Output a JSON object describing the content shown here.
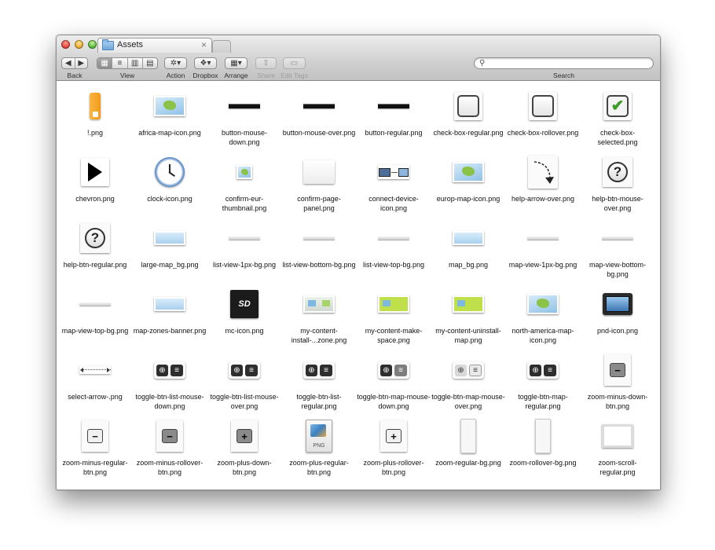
{
  "window": {
    "tab_title": "Assets",
    "tab_close": "×"
  },
  "toolbar": {
    "back_label": "Back",
    "view_label": "View",
    "action_label": "Action",
    "dropbox_label": "Dropbox",
    "arrange_label": "Arrange",
    "share_label": "Share",
    "edit_tags_label": "Edit Tags",
    "search_label": "Search",
    "search_value": "",
    "back_glyph": "◀",
    "forward_glyph": "▶",
    "action_glyph": "✲▾",
    "dropbox_glyph": "❖▾",
    "arrange_glyph": "▦▾",
    "share_glyph": "⇪",
    "edit_tags_glyph": "▭",
    "search_glyph": "⚲",
    "view_icons": [
      "▦",
      "≡",
      "▥",
      "▤"
    ]
  },
  "files": [
    {
      "name": "!.png",
      "kind": "exclaim"
    },
    {
      "name": "africa-map-icon.png",
      "kind": "map"
    },
    {
      "name": "button-mouse-down.png",
      "kind": "blackbar"
    },
    {
      "name": "button-mouse-over.png",
      "kind": "blackbar"
    },
    {
      "name": "button-regular.png",
      "kind": "blackbar"
    },
    {
      "name": "check-box-regular.png",
      "kind": "checkbox"
    },
    {
      "name": "check-box-rollover.png",
      "kind": "checkbox"
    },
    {
      "name": "check-box-selected.png",
      "kind": "checkbox-on"
    },
    {
      "name": "chevron.png",
      "kind": "chevron"
    },
    {
      "name": "clock-icon.png",
      "kind": "clock"
    },
    {
      "name": "confirm-eur-thumbnail.png",
      "kind": "smallmap"
    },
    {
      "name": "confirm-page-panel.png",
      "kind": "panel"
    },
    {
      "name": "connect-device-icon.png",
      "kind": "device"
    },
    {
      "name": "europ-map-icon.png",
      "kind": "map"
    },
    {
      "name": "help-arrow-over.png",
      "kind": "arrow"
    },
    {
      "name": "help-btn-mouse-over.png",
      "kind": "help"
    },
    {
      "name": "help-btn-regular.png",
      "kind": "help"
    },
    {
      "name": "large-map_bg.png",
      "kind": "cloudbar"
    },
    {
      "name": "list-view-1px-bg.png",
      "kind": "thinbar"
    },
    {
      "name": "list-view-bottom-bg.png",
      "kind": "thinbar"
    },
    {
      "name": "list-view-top-bg.png",
      "kind": "thinbar"
    },
    {
      "name": "map_bg.png",
      "kind": "cloudbar"
    },
    {
      "name": "map-view-1px-bg.png",
      "kind": "thinbar"
    },
    {
      "name": "map-view-bottom-bg.png",
      "kind": "thinbar"
    },
    {
      "name": "map-view-top-bg.png",
      "kind": "thinbar"
    },
    {
      "name": "map-zones-banner.png",
      "kind": "cloudbar"
    },
    {
      "name": "mc-icon.png",
      "kind": "sd"
    },
    {
      "name": "my-content-install-...zone.png",
      "kind": "greymap"
    },
    {
      "name": "my-content-make-space.png",
      "kind": "limemap"
    },
    {
      "name": "my-content-uninstall-map.png",
      "kind": "limemap"
    },
    {
      "name": "north-america-map-icon.png",
      "kind": "map"
    },
    {
      "name": "pnd-icon.png",
      "kind": "pnd"
    },
    {
      "name": "select-arrow-.png",
      "kind": "selectarrow"
    },
    {
      "name": "toggle-btn-list-mouse-down.png",
      "kind": "toggle"
    },
    {
      "name": "toggle-btn-list-mouse-over.png",
      "kind": "toggle"
    },
    {
      "name": "toggle-btn-list-regular.png",
      "kind": "toggle"
    },
    {
      "name": "toggle-btn-map-mouse-down.png",
      "kind": "toggle-mid"
    },
    {
      "name": "toggle-btn-map-mouse-over.png",
      "kind": "toggle-light"
    },
    {
      "name": "toggle-btn-map-regular.png",
      "kind": "toggle"
    },
    {
      "name": "zoom-minus-down-btn.png",
      "kind": "zoom-minus-dark"
    },
    {
      "name": "zoom-minus-regular-btn.png",
      "kind": "zoom-minus"
    },
    {
      "name": "zoom-minus-rollover-btn.png",
      "kind": "zoom-minus-dark"
    },
    {
      "name": "zoom-plus-down-btn.png",
      "kind": "zoom-plus-dark"
    },
    {
      "name": "zoom-plus-regular-btn.png",
      "kind": "pngdoc"
    },
    {
      "name": "zoom-plus-rollover-btn.png",
      "kind": "zoom-plus"
    },
    {
      "name": "zoom-regular-bg.png",
      "kind": "tall"
    },
    {
      "name": "zoom-rollover-bg.png",
      "kind": "tall"
    },
    {
      "name": "zoom-scroll-regular.png",
      "kind": "frame"
    }
  ],
  "glyphs": {
    "minus": "−",
    "plus": "+",
    "help": "?",
    "globe": "⊕",
    "list": "≡",
    "sd": "SD",
    "png": "PNG",
    "check": "✔",
    "exclaim": "!"
  },
  "icon_colors": {
    "exclaim": "#f39a1a",
    "check": "#3e9b2a",
    "clock": "#4a7fc1"
  }
}
